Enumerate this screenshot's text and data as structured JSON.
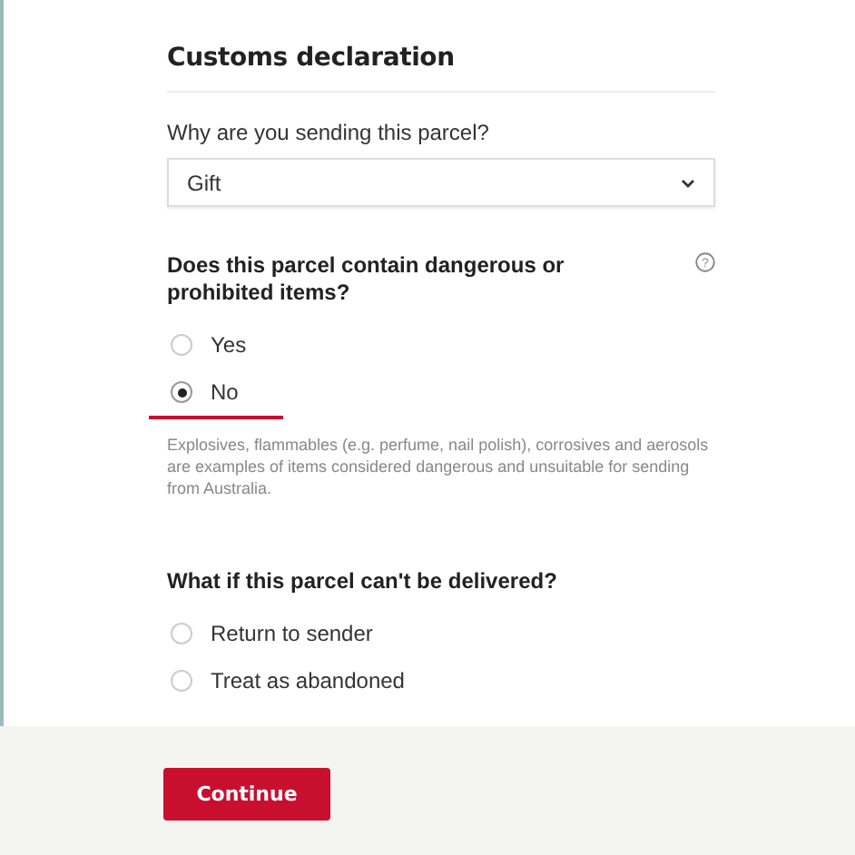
{
  "title": "Customs declaration",
  "reason": {
    "label": "Why are you sending this parcel?",
    "value": "Gift"
  },
  "dangerous": {
    "question": "Does this parcel contain dangerous or prohibited items?",
    "help_icon": "?",
    "options": [
      {
        "label": "Yes",
        "selected": false
      },
      {
        "label": "No",
        "selected": true
      }
    ],
    "note": "Explosives, flammables (e.g. perfume, nail polish), corrosives and aerosols are examples of items considered dangerous and unsuitable for sending from Australia."
  },
  "undeliverable": {
    "question": "What if this parcel can't be delivered?",
    "options": [
      {
        "label": "Return to sender",
        "selected": false
      },
      {
        "label": "Treat as abandoned",
        "selected": false
      }
    ]
  },
  "continue_button": "Continue"
}
